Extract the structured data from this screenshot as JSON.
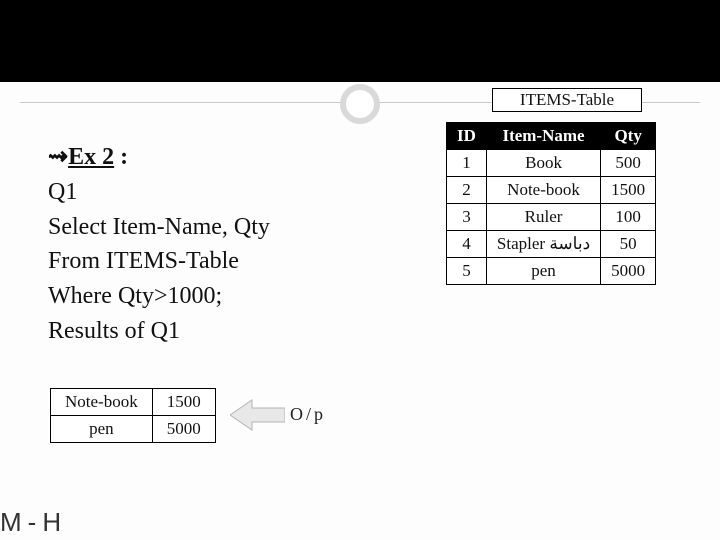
{
  "items_label": "ITEMS-Table",
  "items_table": {
    "headers": {
      "id": "ID",
      "name": "Item-Name",
      "qty": "Qty"
    },
    "rows": [
      {
        "id": "1",
        "name": "Book",
        "qty": "500"
      },
      {
        "id": "2",
        "name": "Note-book",
        "qty": "1500"
      },
      {
        "id": "3",
        "name": "Ruler",
        "qty": "100"
      },
      {
        "id": "4",
        "name": "Stapler دباسة",
        "qty": "50"
      },
      {
        "id": "5",
        "name": "pen",
        "qty": "5000"
      }
    ]
  },
  "query": {
    "ex_prefix": "⇝",
    "ex_label": "Ex 2",
    "colon": " :",
    "line1": "Q1",
    "line2": "Select Item-Name, Qty",
    "line3": "From ITEMS-Table",
    "line4": "Where Qty>1000;",
    "line5": "Results of Q1"
  },
  "result_table": {
    "rows": [
      {
        "name": "Note-book",
        "qty": "1500"
      },
      {
        "name": "pen",
        "qty": "5000"
      }
    ]
  },
  "op_label": "O/p",
  "footer": "M-H",
  "chart_data": {
    "type": "table",
    "title": "ITEMS-Table",
    "columns": [
      "ID",
      "Item-Name",
      "Qty"
    ],
    "rows": [
      [
        1,
        "Book",
        500
      ],
      [
        2,
        "Note-book",
        1500
      ],
      [
        3,
        "Ruler",
        100
      ],
      [
        4,
        "Stapler دباسة",
        50
      ],
      [
        5,
        "pen",
        5000
      ]
    ],
    "query": "Select Item-Name, Qty From ITEMS-Table Where Qty>1000;",
    "query_result_columns": [
      "Item-Name",
      "Qty"
    ],
    "query_result_rows": [
      [
        "Note-book",
        1500
      ],
      [
        "pen",
        5000
      ]
    ]
  }
}
